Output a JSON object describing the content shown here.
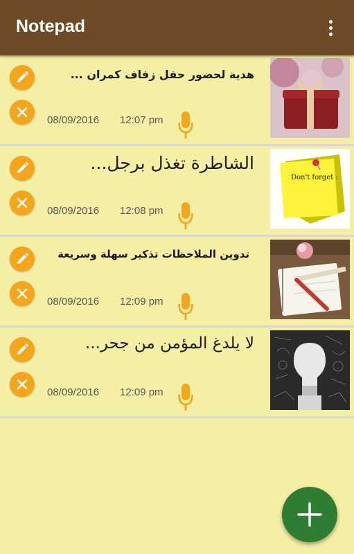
{
  "appbar": {
    "title": "Notepad",
    "menu_icon": "more-vert-icon",
    "background": "#6f4a26"
  },
  "colors": {
    "background": "#f4efa4",
    "action_button": "#f4a51c",
    "fab": "#2f7d32"
  },
  "notes": [
    {
      "title": "هدية لحضور حفل زفاف كمران ...",
      "date": "08/09/2016",
      "time": "12:07 pm",
      "image": "gift-box-image"
    },
    {
      "title": "الشاطرة تغذل برجل...",
      "date": "08/09/2016",
      "time": "12:08 pm",
      "image": "sticky-note-dont-forget-image",
      "image_text": "Don't forget :"
    },
    {
      "title": "تدوين الملاحظات تذكير سهلة وسريعة",
      "date": "08/09/2016",
      "time": "12:09 pm",
      "image": "notebook-pencil-image"
    },
    {
      "title": "لا يلدغ المؤمن من جحر...",
      "date": "08/09/2016",
      "time": "12:09 pm",
      "image": "lightbulb-chalkboard-image"
    }
  ],
  "fab": {
    "icon": "plus-icon"
  }
}
